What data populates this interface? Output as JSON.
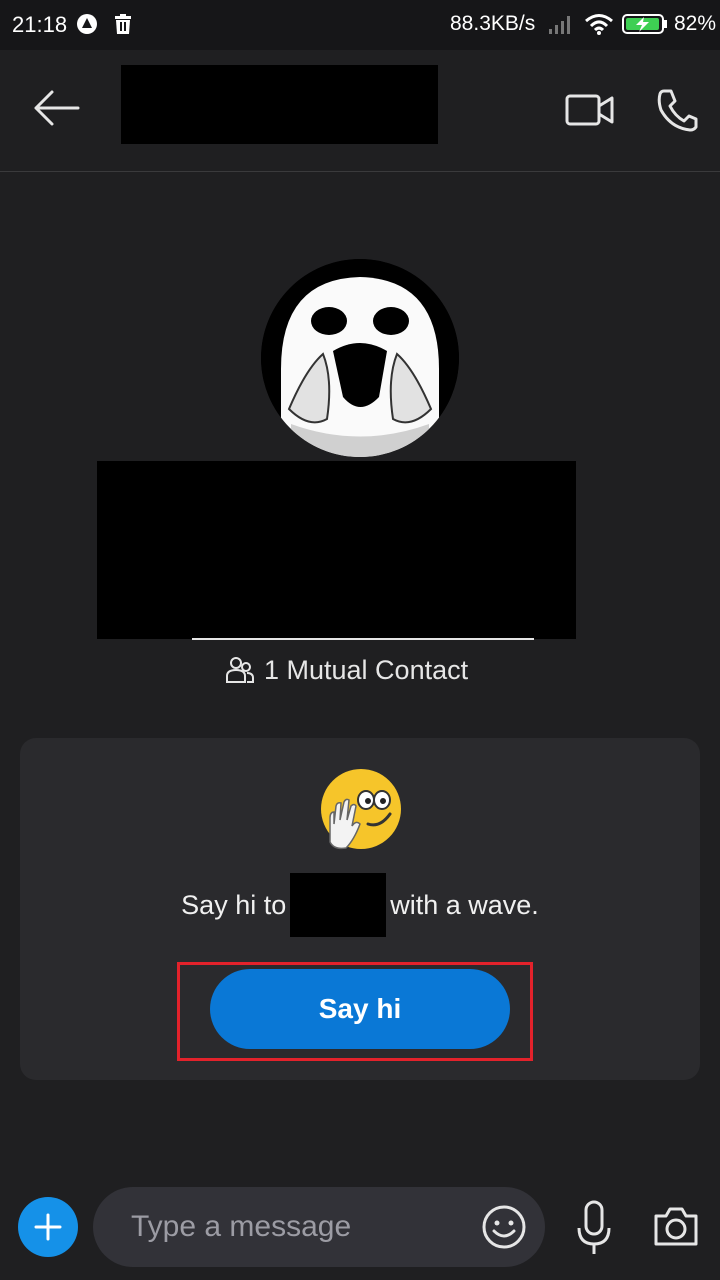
{
  "status_bar": {
    "time": "21:18",
    "net_speed": "88.3KB/s",
    "battery_pct": "82%",
    "icons": [
      "app-notification-icon",
      "trash-icon",
      "signal-icon",
      "wifi-icon",
      "battery-charging-icon"
    ]
  },
  "header": {
    "icons": [
      "back-arrow-icon",
      "video-call-icon",
      "phone-icon"
    ]
  },
  "profile": {
    "mutual_contacts": "1 Mutual Contact",
    "mutual_icon": "people-icon"
  },
  "wave_card": {
    "prefix": "Say hi to",
    "suffix": "with a wave.",
    "button_label": "Say hi",
    "emoji": "waving-emoji-icon"
  },
  "composer": {
    "placeholder": "Type a message",
    "icons": [
      "plus-icon",
      "emoji-icon",
      "microphone-icon",
      "camera-icon"
    ]
  },
  "colors": {
    "background": "#1f1f21",
    "accent": "#0a78d6",
    "highlight": "#e3222b"
  }
}
